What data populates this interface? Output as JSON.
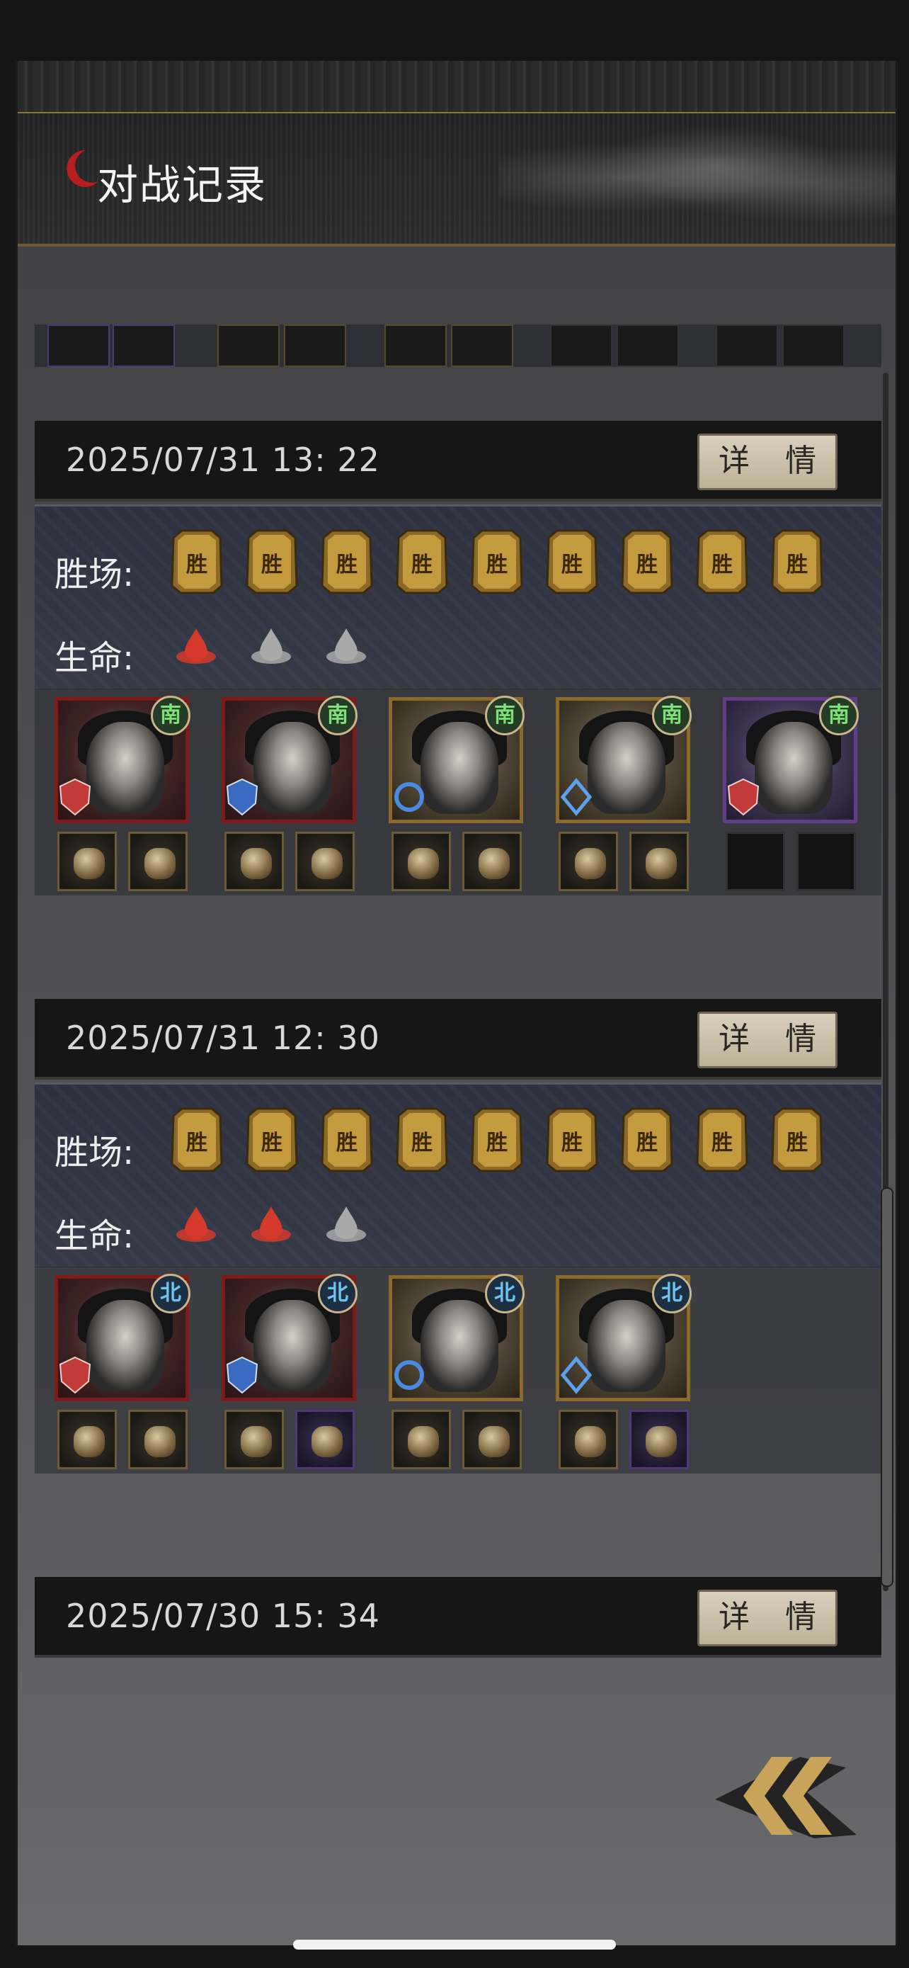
{
  "page": {
    "title": "对战记录"
  },
  "labels": {
    "wins": "胜场:",
    "life": "生命:",
    "detail": "详 情",
    "win_card_char": "胜"
  },
  "records": [
    {
      "datetime": "2025/07/31    13: 22",
      "wins": 9,
      "life": [
        "red",
        "gray",
        "gray"
      ],
      "heroes": [
        {
          "faction": "南",
          "frame": "red",
          "items": [
            "gold",
            "gold"
          ]
        },
        {
          "faction": "南",
          "frame": "red",
          "items": [
            "gold",
            "gold"
          ]
        },
        {
          "faction": "南",
          "frame": "gold",
          "items": [
            "gold",
            "gold"
          ]
        },
        {
          "faction": "南",
          "frame": "gold",
          "items": [
            "gold",
            "gold"
          ]
        },
        {
          "faction": "南",
          "frame": "purple",
          "items": [
            "empty",
            "empty"
          ]
        }
      ]
    },
    {
      "datetime": "2025/07/31    12: 30",
      "wins": 9,
      "life": [
        "red",
        "red",
        "gray"
      ],
      "heroes": [
        {
          "faction": "北",
          "frame": "red",
          "items": [
            "gold",
            "gold"
          ]
        },
        {
          "faction": "北",
          "frame": "red",
          "items": [
            "gold",
            "purple"
          ]
        },
        {
          "faction": "北",
          "frame": "gold",
          "items": [
            "gold",
            "gold"
          ]
        },
        {
          "faction": "北",
          "frame": "gold",
          "items": [
            "gold",
            "purple"
          ]
        }
      ]
    },
    {
      "datetime": "2025/07/30    15: 34"
    }
  ],
  "colors": {
    "accent_gold": "#8b6a2e",
    "life_red": "#d33a2c",
    "life_gray": "#a9a9a9",
    "button_bg": "#cfc4ad",
    "faction_south": "#7fe07a",
    "faction_north": "#6fc3f0"
  },
  "icons": {
    "title": "crescent-logo-icon",
    "back": "double-chevron-left-icon",
    "win": "win-token-icon",
    "life": "life-drop-icon"
  }
}
